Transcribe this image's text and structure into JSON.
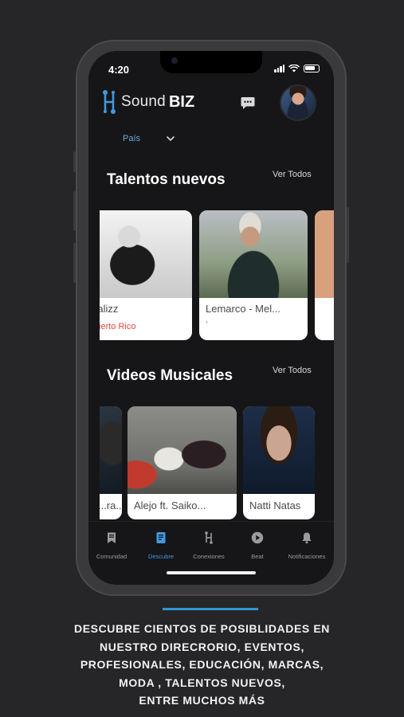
{
  "status_bar": {
    "time": "4:20"
  },
  "header": {
    "logo_sound": "Sound",
    "logo_biz": "BIZ"
  },
  "filter": {
    "country_label": "País"
  },
  "talents": {
    "title": "Talentos nuevos",
    "see_all": "Ver Todos",
    "cards": [
      {
        "name": "Dalizz",
        "location": "Puerto Rico"
      },
      {
        "name": "Lemarco - Mel...",
        "location": "."
      }
    ]
  },
  "videos": {
    "title": "Videos Musicales",
    "see_all": "Ver Todos",
    "cards": [
      {
        "name": "...ra..."
      },
      {
        "name": "Alejo ft. Saiko..."
      },
      {
        "name": "Natti Natas"
      }
    ]
  },
  "tabs": [
    {
      "label": "Comunidad",
      "icon": "bookmark-icon"
    },
    {
      "label": "Descubre",
      "icon": "book-icon",
      "active": true
    },
    {
      "label": "Conexiones",
      "icon": "network-icon"
    },
    {
      "label": "Beat",
      "icon": "play-circle-icon"
    },
    {
      "label": "Notificaciones",
      "icon": "bell-icon"
    }
  ],
  "caption": {
    "line1": "DESCUBRE CIENTOS DE POSIBLIDADES EN",
    "line2": "NUESTRO DIRECRORIO, EVENTOS,",
    "line3": "PROFESIONALES, EDUCACIÓN, MARCAS,",
    "line4": "MODA , TALENTOS NUEVOS,",
    "line5": "ENTRE MUCHOS MÁS"
  },
  "colors": {
    "accent": "#2f96d8",
    "location_red": "#e2463e",
    "background": "#262628"
  }
}
